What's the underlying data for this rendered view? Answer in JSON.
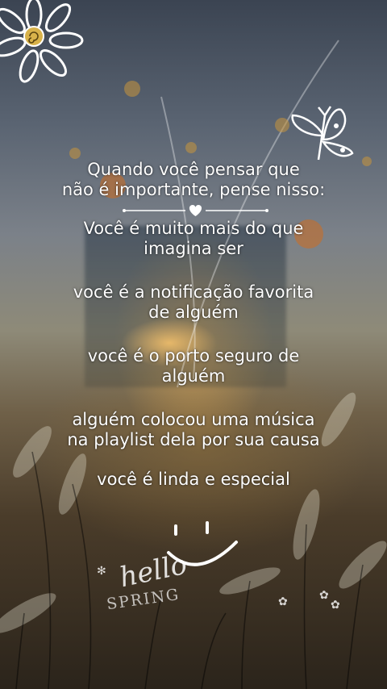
{
  "message": {
    "intro_line1": "Quando você pensar que",
    "intro_line2": "não é importante, pense nisso:",
    "p1_line1": "Você é muito mais do que",
    "p1_line2": "imagina ser",
    "p2_line1": "você é a notificação favorita",
    "p2_line2": "de alguém",
    "p3_line1": "você é o porto seguro de",
    "p3_line2": "alguém",
    "p4_line1": "alguém colocou uma música",
    "p4_line2": "na playlist dela por sua causa",
    "p5_line1": "você é linda e especial"
  },
  "decor": {
    "top_left": "flower-icon",
    "top_right": "butterfly-icon",
    "center_divider": "heart-divider-icon",
    "bottom": "smiley-face-icon",
    "sticker_hello": "hello",
    "sticker_spring": "SPRING"
  },
  "colors": {
    "text": "#ffffff",
    "flower_center": "#d8b24a"
  }
}
